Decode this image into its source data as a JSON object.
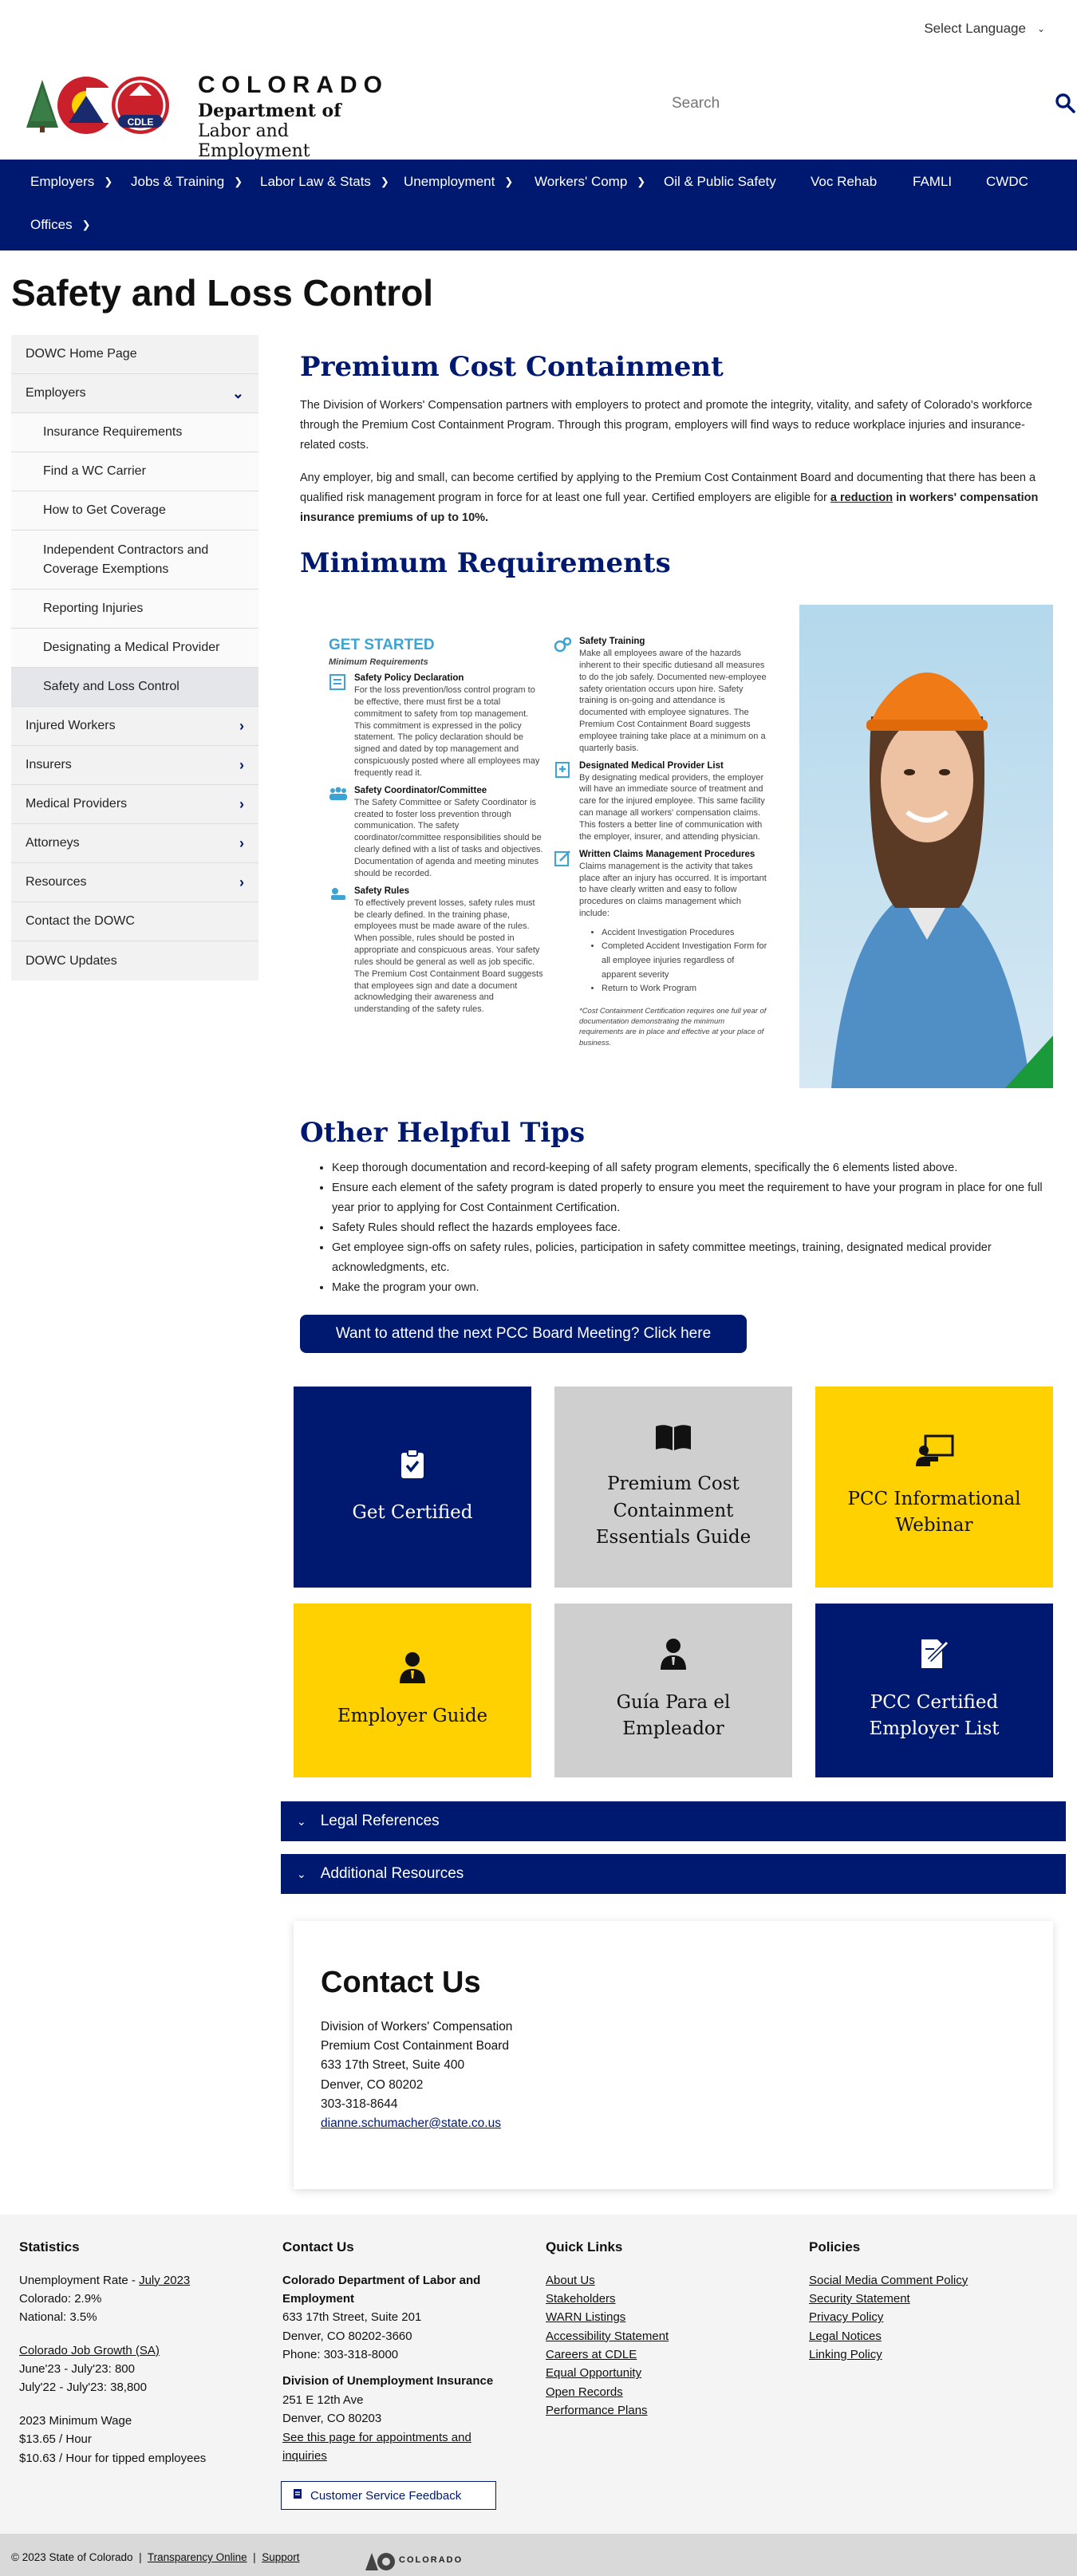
{
  "header": {
    "language": "Select Language",
    "logo_state": "COLORADO",
    "logo_badge": "CDLE",
    "logo_dept_line1": "Department of",
    "logo_dept_line2": "Labor and Employment",
    "search_placeholder": "Search"
  },
  "nav": {
    "items": [
      {
        "label": "Employers"
      },
      {
        "label": "Jobs & Training"
      },
      {
        "label": "Labor Law & Stats"
      },
      {
        "label": "Unemployment"
      },
      {
        "label": "Workers' Comp"
      },
      {
        "label": "Oil & Public Safety"
      },
      {
        "label": "Voc Rehab"
      },
      {
        "label": "FAMLI"
      },
      {
        "label": "CWDC"
      },
      {
        "label": "Offices"
      }
    ]
  },
  "page_title": "Safety and Loss Control",
  "sidebar": {
    "items": [
      {
        "label": "DOWC Home Page"
      },
      {
        "label": "Employers"
      },
      {
        "label": "Insurance Requirements"
      },
      {
        "label": "Find a WC Carrier"
      },
      {
        "label": "How to Get Coverage"
      },
      {
        "label": "Independent Contractors and Coverage Exemptions"
      },
      {
        "label": "Reporting Injuries"
      },
      {
        "label": "Designating a Medical Provider"
      },
      {
        "label": "Safety and Loss Control"
      },
      {
        "label": "Injured Workers"
      },
      {
        "label": "Insurers"
      },
      {
        "label": "Medical Providers"
      },
      {
        "label": "Attorneys"
      },
      {
        "label": "Resources"
      },
      {
        "label": "Contact the DOWC"
      },
      {
        "label": "DOWC Updates"
      }
    ]
  },
  "main": {
    "heading1": "Premium Cost Containment",
    "para1": "The Division of Workers' Compensation partners with employers to protect and promote the integrity, vitality, and safety of Colorado's workforce through the Premium Cost Containment Program. Through this program, employers will find ways to reduce workplace injuries and insurance-related costs.",
    "para2_a": "Any employer, big and small, can become certified by applying to the Premium Cost Containment Board and documenting that there has been a qualified risk management program in force for at least one full year. Certified employers are eligible for ",
    "para2_link": "a reduction",
    "para2_b": " in workers' compensation insurance premiums of up to 10%.",
    "heading2": "Minimum Requirements",
    "heading3": "Other Helpful Tips",
    "tips": [
      "Keep thorough documentation and record-keeping of all safety program elements, specifically the 6 elements listed above.",
      "Ensure each element of the safety program is dated properly to ensure you meet the requirement to have your program in place for one full year prior to applying for Cost Containment Certification.",
      "Safety Rules should reflect the hazards employees face.",
      "Get employee sign-offs on safety rules, policies, participation in safety committee meetings, training, designated medical provider acknowledgments, etc.",
      "Make the program your own."
    ],
    "pcc_button": "Want to attend the next PCC Board Meeting? Click here"
  },
  "infographic": {
    "title": "GET STARTED",
    "subtitle": "Minimum Requirements",
    "blocks": [
      {
        "title": "Safety Policy Declaration",
        "text": "For the loss prevention/loss control program to be effective, there must first be a total commitment to safety from top management. This commitment is expressed in the policy statement. The policy declaration should be signed and dated by top management and conspicuously posted where all employees may frequently read it."
      },
      {
        "title": "Safety Coordinator/Committee",
        "text": "The Safety Committee or Safety Coordinator is created to foster loss prevention through communication. The safety coordinator/committee responsibilities should be clearly defined with a list of tasks and objectives. Documentation of agenda and meeting minutes should be recorded."
      },
      {
        "title": "Safety Rules",
        "text": "To effectively prevent losses, safety rules must be clearly defined. In the training phase, employees must be made aware of the rules. When possible, rules should be posted in appropriate and conspicuous areas. Your safety rules should be general as well as job specific. The Premium Cost Containment Board suggests that employees sign and date a document acknowledging their awareness and understanding of the safety rules."
      },
      {
        "title": "Safety Training",
        "text": "Make all employees aware of the hazards inherent to their specific dutiesand all measures to do the job safely. Documented new-employee safety orientation occurs upon hire. Safety training is on-going and attendance is documented with employee signatures. The Premium Cost Containment Board suggests employee training take place at a minimum on a quarterly basis."
      },
      {
        "title": "Designated Medical Provider List",
        "text": "By designating medical providers, the employer will have an immediate source of treatment and care for the injured employee. This same facility can manage all workers' compensation claims. This fosters a better line of communication with the employer, insurer, and attending physician."
      },
      {
        "title": "Written Claims Management Procedures",
        "text": "Claims management is the activity that takes place after an injury has occurred. It is important to have clearly written and easy to follow procedures on claims management which include:"
      }
    ],
    "claims_list": [
      "Accident Investigation Procedures",
      "Completed Accident Investigation Form for all employee injuries regardless of apparent severity",
      "Return to Work Program"
    ],
    "footnote": "*Cost Containment Certification requires one full year of documentation demonstrating the minimum requirements are in place and effective at your place of business."
  },
  "tiles": [
    {
      "label": "Get Certified",
      "icon": "clipboard-check-icon"
    },
    {
      "label": "Premium Cost Containment Essentials Guide",
      "icon": "book-icon"
    },
    {
      "label": "PCC Informational Webinar",
      "icon": "presenter-icon"
    },
    {
      "label": "Employer Guide",
      "icon": "person-icon"
    },
    {
      "label": "Guía Para el Empleador",
      "icon": "person-icon"
    },
    {
      "label": "PCC Certified Employer List",
      "icon": "certified-doc-icon"
    }
  ],
  "accordions": [
    {
      "label": "Legal References"
    },
    {
      "label": "Additional Resources"
    }
  ],
  "contact": {
    "title": "Contact Us",
    "lines": [
      "Division of Workers' Compensation",
      "Premium Cost Containment Board",
      "633 17th Street, Suite 400",
      "Denver, CO 80202",
      "303-318-8644"
    ],
    "email": "dianne.schumacher@state.co.us"
  },
  "footer": {
    "statistics": {
      "title": "Statistics",
      "unemp_label": "Unemployment Rate - ",
      "unemp_link": "July 2023",
      "colorado": "Colorado: 2.9%",
      "national": "National: 3.5%",
      "job_growth_link": "Colorado Job Growth (SA)",
      "jg1": "June'23 - July'23: 800",
      "jg2": "July'22 - July'23: 38,800",
      "min_wage_title": "2023 Minimum Wage",
      "mw1": "$13.65 / Hour",
      "mw2": "$10.63 / Hour for tipped employees"
    },
    "contact": {
      "title": "Contact Us",
      "org": "Colorado Department of Labor and Employment",
      "addr1": "633 17th Street, Suite 201",
      "addr2": "Denver, CO  80202-3660",
      "phone": "Phone: 303-318-8000",
      "div": "Division of Unemployment Insurance",
      "d_addr1": "251 E 12th Ave",
      "d_addr2": "Denver, CO  80203",
      "appt_link": "See this page for appointments and inquiries"
    },
    "quick_links": {
      "title": "Quick Links",
      "links": [
        "About Us",
        "Stakeholders",
        "WARN Listings",
        "Accessibility Statement",
        "Careers at CDLE",
        "Equal Opportunity",
        "Open Records",
        "Performance Plans"
      ]
    },
    "policies": {
      "title": "Policies",
      "links": [
        "Social Media Comment Policy",
        "Security Statement",
        "Privacy Policy",
        "Legal Notices",
        "Linking Policy"
      ]
    },
    "feedback_button": "Customer Service Feedback"
  },
  "bottom_bar": {
    "copyright": "© 2023 State of Colorado",
    "transparency": "Transparency Online",
    "support": "Support",
    "logo_text": "COLORADO"
  },
  "colors": {
    "navy": "#001970",
    "yellow": "#ffd100",
    "gray": "#cfcfcf",
    "cyan": "#3ca4d4"
  }
}
